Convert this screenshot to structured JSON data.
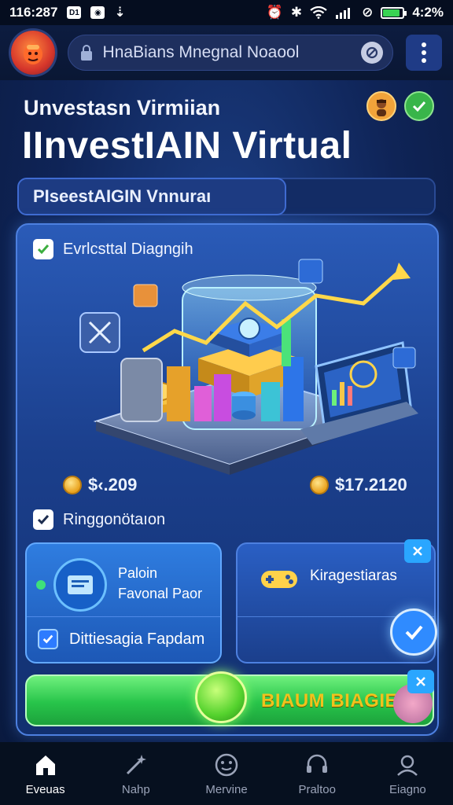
{
  "status_bar": {
    "time": "116:287",
    "battery_level": 0.8,
    "battery_text": "4:2%",
    "battery_color": "#39d353"
  },
  "top_bar": {
    "url_text": "HnaBians Mnegnal Noaool",
    "icons": [
      "app-logo-icon",
      "lock-icon",
      "reload-icon",
      "more-vertical-icon"
    ]
  },
  "header": {
    "subtitle": "Unvestasn Virmiian",
    "title": "IInvestIAIN Virtual",
    "icons": [
      "avatar-icon",
      "check-circle-icon"
    ]
  },
  "tab": {
    "label": "PIseestAIGIN Vnnuraı"
  },
  "card": {
    "diagram_label": "Evrlcsttal Diagngih",
    "amount_left": "$‹.209",
    "amount_right": "$17.2120",
    "registration_label": "Ringgonötaıon",
    "tile_left": {
      "line1": "Paloin",
      "line2": "Favonal Paor",
      "check_label": "Dittiesagia Fapdam"
    },
    "tile_right": {
      "label": "Kiragestiaras"
    },
    "cta_label": "BIAUM BIAGIEI"
  },
  "accent_colors": {
    "primary_blue": "#2f7de0",
    "success_green": "#39b54a",
    "cta_green": "#27c44a",
    "cta_text": "#f0c21d"
  },
  "bottom_nav": {
    "items": [
      {
        "label": "Eveuas",
        "icon": "home-icon",
        "active": true
      },
      {
        "label": "Nahp",
        "icon": "wand-icon",
        "active": false
      },
      {
        "label": "Mervine",
        "icon": "face-icon",
        "active": false
      },
      {
        "label": "Praltoo",
        "icon": "headset-icon",
        "active": false
      },
      {
        "label": "Eiagno",
        "icon": "profile-icon",
        "active": false
      }
    ]
  }
}
